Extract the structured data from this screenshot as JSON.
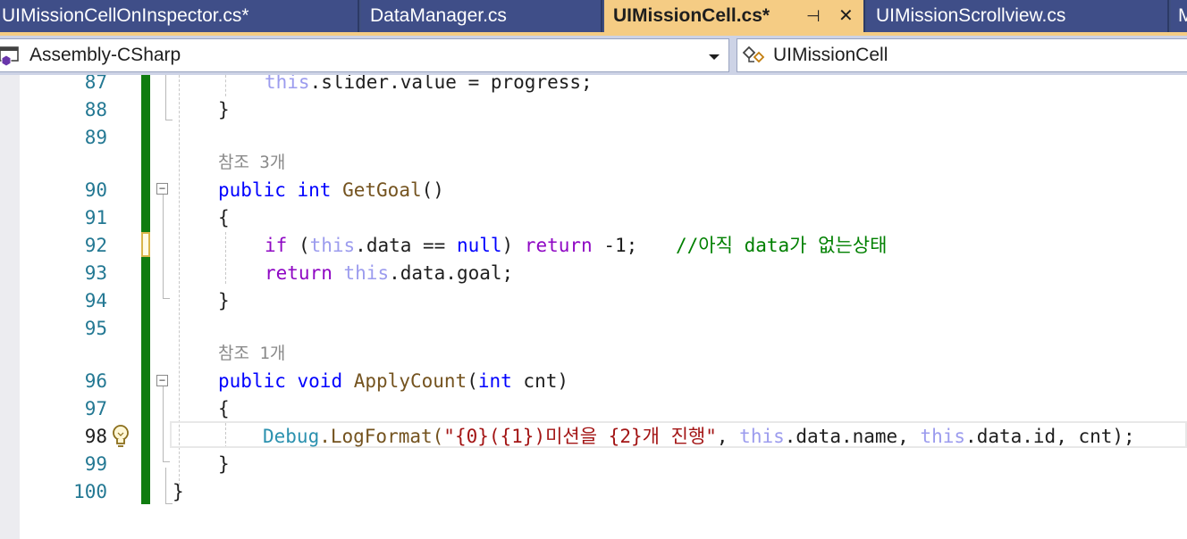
{
  "tabs": [
    {
      "label": "UIMissionCellOnInspector.cs*",
      "active": false
    },
    {
      "label": "DataManager.cs",
      "active": false
    },
    {
      "label": "UIMissionCell.cs*",
      "active": true
    },
    {
      "label": "UIMissionScrollview.cs",
      "active": false
    },
    {
      "label": "M",
      "active": false
    }
  ],
  "tab_buttons": {
    "pin": "⊣",
    "close": "✕"
  },
  "nav": {
    "project": "Assembly-CSharp",
    "class": "UIMissionCell"
  },
  "lines": {
    "l87": "87",
    "l88": "88",
    "l89": "89",
    "l90": "90",
    "l91": "91",
    "l92": "92",
    "l93": "93",
    "l94": "94",
    "l95": "95",
    "l96": "96",
    "l97": "97",
    "l98": "98",
    "l99": "99",
    "l100": "100"
  },
  "refs": {
    "getgoal": "참조 3개",
    "applycount": "참조 1개"
  },
  "code": {
    "c87_this": "this",
    "c87_rest": ".slider.value = progress;",
    "brace_close": "}",
    "brace_open": "{",
    "public": "public",
    "int": "int",
    "void": "void",
    "getgoal": "GetGoal",
    "parens": "()",
    "if": "if",
    "this": "this",
    "null": "null",
    "return": "return",
    "c92_a": " (",
    "c92_b": ".data == ",
    "c92_c": ") ",
    "c92_d": " -1;",
    "c92_comment": "//아직 data가 없는상태",
    "c93_rest": ".data.goal;",
    "applycount": "ApplyCount",
    "paren_open": "(",
    "cnt_param": " cnt)",
    "debug": "Debug",
    "logformat": ".LogFormat(",
    "fmt_string": "\"{0}({1})미션을 {2}개 진행\"",
    "c98_b": ", ",
    "c98_c": ".data.name, ",
    "c98_d": ".data.id, cnt);"
  },
  "colors": {
    "accent_tab": "#f5cc84",
    "change_bar": "#107c10",
    "keyword": "#0000ff",
    "control_keyword": "#8f08c4"
  }
}
